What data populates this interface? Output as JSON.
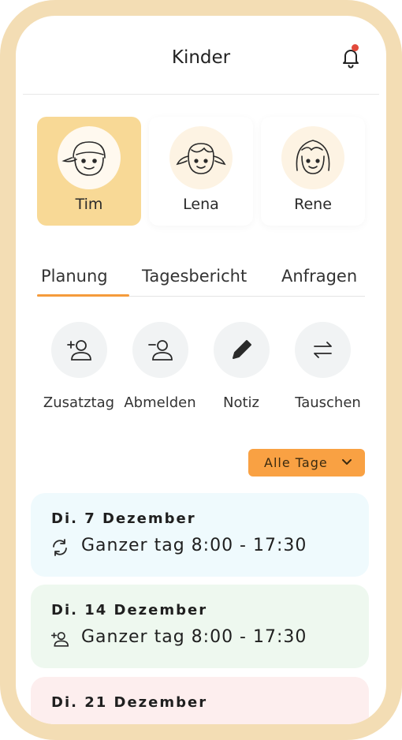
{
  "header": {
    "title": "Kinder",
    "notification_icon": "bell-icon",
    "notification_dot_color": "#e24a3b"
  },
  "children": [
    {
      "name": "Tim",
      "selected": true,
      "avatar_icon": "boy-cap-avatar"
    },
    {
      "name": "Lena",
      "selected": false,
      "avatar_icon": "girl-pigtails-avatar"
    },
    {
      "name": "Rene",
      "selected": false,
      "avatar_icon": "girl-bob-avatar"
    }
  ],
  "tabs": [
    {
      "label": "Planung",
      "active": true
    },
    {
      "label": "Tagesbericht",
      "active": false
    },
    {
      "label": "Anfragen",
      "active": false
    }
  ],
  "actions": [
    {
      "label": "Zusatztag",
      "icon": "user-plus-icon"
    },
    {
      "label": "Abmelden",
      "icon": "user-minus-icon"
    },
    {
      "label": "Notiz",
      "icon": "pencil-icon"
    },
    {
      "label": "Tauschen",
      "icon": "swap-arrows-icon"
    }
  ],
  "filter": {
    "label": "Alle Tage",
    "icon": "chevron-down-icon"
  },
  "days": [
    {
      "date": "Di. 7 Dezember",
      "text": "Ganzer tag 8:00 - 17:30",
      "icon": "refresh-icon",
      "color": "#effafd"
    },
    {
      "date": "Di. 14 Dezember",
      "text": "Ganzer tag 8:00 - 17:30",
      "icon": "user-plus-icon",
      "color": "#eef8ef"
    },
    {
      "date": "Di. 21 Dezember",
      "text": "",
      "icon": "",
      "color": "#fdeeee"
    }
  ],
  "colors": {
    "accent": "#f59b3c",
    "frame": "#f3ddb4",
    "selected_card": "#f8d996"
  }
}
